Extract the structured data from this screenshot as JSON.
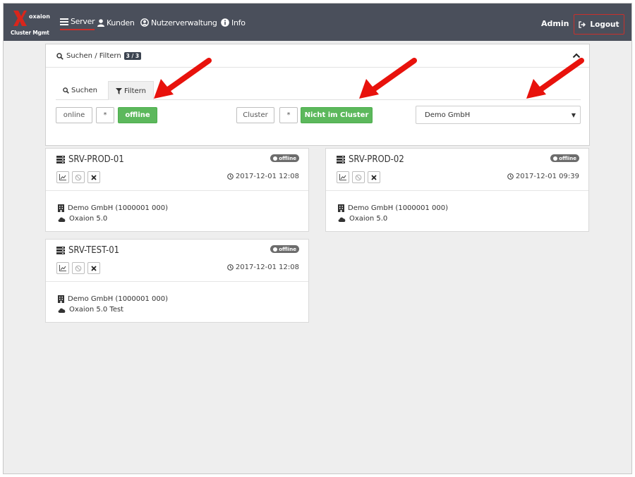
{
  "app": {
    "brand_name": "oxaion",
    "brand_subtitle": "Cluster Mgmt"
  },
  "nav": {
    "items": [
      {
        "label": "Server",
        "icon": "list-icon",
        "active": true
      },
      {
        "label": "Kunden",
        "icon": "user-icon",
        "active": false
      },
      {
        "label": "Nutzerverwaltung",
        "icon": "user-circle-icon",
        "active": false
      },
      {
        "label": "Info",
        "icon": "info-icon",
        "active": false
      }
    ],
    "user": "Admin",
    "logout_label": "Logout"
  },
  "filter_panel": {
    "title": "Suchen / Filtern",
    "count_badge": "3 / 3",
    "tabs": [
      {
        "label": "Suchen",
        "icon": "search-icon",
        "active": false
      },
      {
        "label": "Filtern",
        "icon": "filter-icon",
        "active": true
      }
    ],
    "status_filter": {
      "options": [
        "online",
        "*",
        "offline"
      ],
      "selected": "offline"
    },
    "cluster_filter": {
      "options": [
        "Cluster",
        "*",
        "Nicht im Cluster"
      ],
      "selected": "Nicht im Cluster"
    },
    "customer_select": {
      "value": "Demo GmbH"
    }
  },
  "servers": [
    {
      "name": "SRV-PROD-01",
      "status": "offline",
      "time": "2017-12-01 12:08",
      "customer": "Demo GmbH (1000001 000)",
      "version": "Oxaion 5.0"
    },
    {
      "name": "SRV-PROD-02",
      "status": "offline",
      "time": "2017-12-01 09:39",
      "customer": "Demo GmbH (1000001 000)",
      "version": "Oxaion 5.0"
    },
    {
      "name": "SRV-TEST-01",
      "status": "offline",
      "time": "2017-12-01 12:08",
      "customer": "Demo GmbH (1000001 000)",
      "version": "Oxaion 5.0 Test"
    }
  ],
  "colors": {
    "navbar": "#4a4f5b",
    "accent_red": "#c9302c",
    "selected_green": "#5cb85c",
    "status_badge": "#6c6c6c",
    "annotation_arrow": "#e8120c"
  }
}
